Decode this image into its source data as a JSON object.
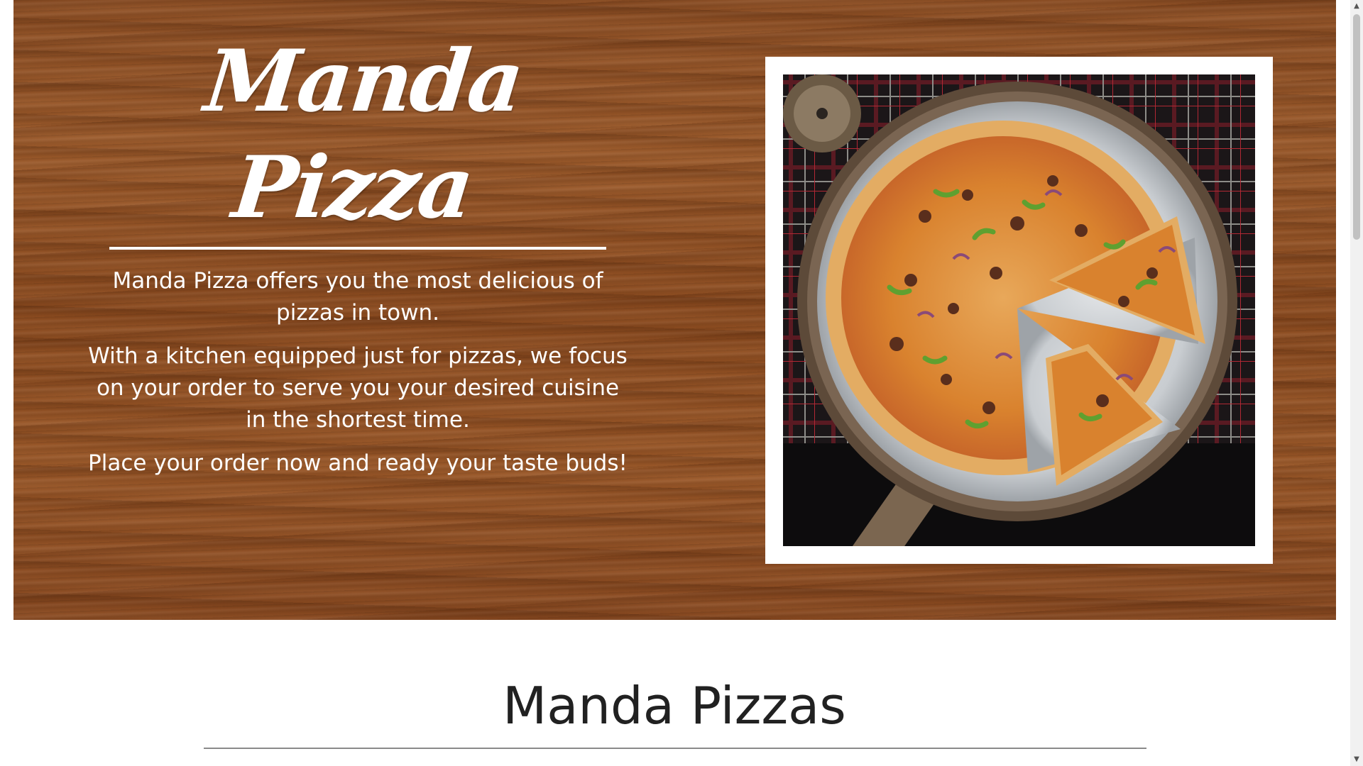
{
  "hero": {
    "brand_title": "Manda Pizza",
    "paragraphs": [
      "Manda Pizza offers you the most delicious of pizzas in town.",
      "With a kitchen equipped just for pizzas, we focus on your order to serve you your desired cuisine in the shortest time.",
      "Place your order now and ready your taste buds!"
    ]
  },
  "menu_section": {
    "title": "Manda Pizzas"
  },
  "scrollbar": {
    "up_glyph": "▲",
    "down_glyph": "▼"
  },
  "colors": {
    "wood": "#8c4e24",
    "text_light": "#ffffff",
    "heading_dark": "#212121"
  }
}
